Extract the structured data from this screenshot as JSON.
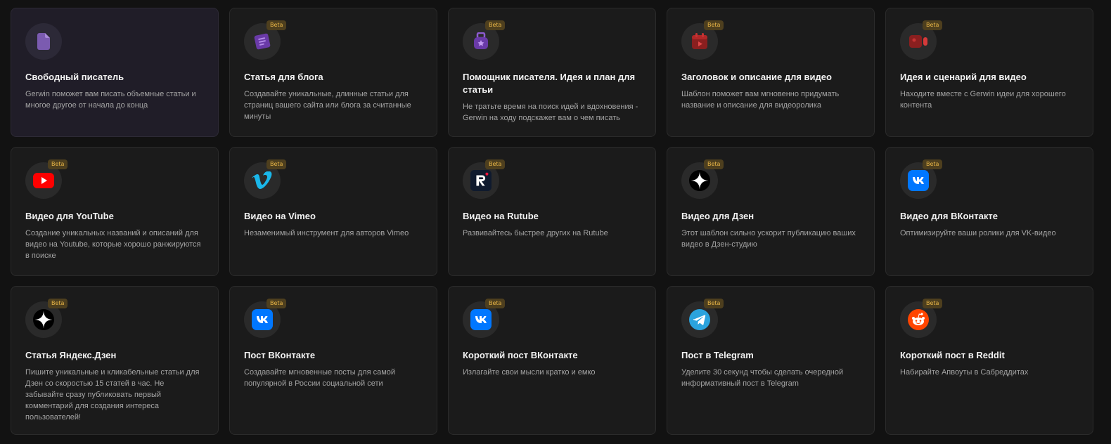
{
  "badge_label": "Beta",
  "cards": [
    {
      "title": "Свободный писатель",
      "desc": "Gerwin поможет вам писать объемные статьи и многое другое от начала до конца",
      "icon": "document-icon",
      "beta": false
    },
    {
      "title": "Статья для блога",
      "desc": "Создавайте уникальные, длинные статьи для страниц вашего сайта или блога за считанные минуты",
      "icon": "blog-article-icon",
      "beta": true
    },
    {
      "title": "Помощник писателя. Идея и план для статьи",
      "desc": "Не тратьте время на поиск идей и вдохновения - Gerwin на ходу подскажет вам о чем писать",
      "icon": "writer-assistant-icon",
      "beta": true
    },
    {
      "title": "Заголовок и описание для видео",
      "desc": "Шаблон поможет вам мгновенно придумать название и описание для видеоролика",
      "icon": "video-calendar-icon",
      "beta": true
    },
    {
      "title": "Идея и сценарий для видео",
      "desc": "Находите вместе с Gerwin идеи для хорошего контента",
      "icon": "video-camera-icon",
      "beta": true
    },
    {
      "title": "Видео для YouTube",
      "desc": "Создание уникальных названий и описаний для видео на Youtube, которые хорошо ранжируются в поиске",
      "icon": "youtube-icon",
      "beta": true
    },
    {
      "title": "Видео на Vimeo",
      "desc": "Незаменимый инструмент для авторов Vimeo",
      "icon": "vimeo-icon",
      "beta": true
    },
    {
      "title": "Видео на Rutube",
      "desc": "Развивайтесь быстрее других на Rutube",
      "icon": "rutube-icon",
      "beta": true
    },
    {
      "title": "Видео для Дзен",
      "desc": "Этот шаблон сильно ускорит публикацию ваших видео в Дзен-студию",
      "icon": "dzen-icon",
      "beta": true
    },
    {
      "title": "Видео для ВКонтакте",
      "desc": "Оптимизируйте ваши ролики для VK-видео",
      "icon": "vk-icon",
      "beta": true
    },
    {
      "title": "Статья Яндекс.Дзен",
      "desc": "Пишите уникальные и кликабельные статьи для Дзен со скоростью 15 статей в час. Не забывайте сразу публиковать первый комментарий для создания интереса пользователей!",
      "icon": "dzen-icon",
      "beta": true
    },
    {
      "title": "Пост ВКонтакте",
      "desc": "Создавайте мгновенные посты для самой популярной в России социальной сети",
      "icon": "vk-icon",
      "beta": true
    },
    {
      "title": "Короткий пост ВКонтакте",
      "desc": "Излагайте свои мысли кратко и емко",
      "icon": "vk-icon",
      "beta": true
    },
    {
      "title": "Пост в Telegram",
      "desc": "Уделите 30 секунд чтобы сделать очередной информативный пост в Telegram",
      "icon": "telegram-icon",
      "beta": true
    },
    {
      "title": "Короткий пост в Reddit",
      "desc": "Набирайте Апвоуты в Сабреддитах",
      "icon": "reddit-icon",
      "beta": true
    }
  ],
  "colors": {
    "background": "#121212",
    "card": "#1b1b1b",
    "card_selected": "#201d28",
    "badge_text": "#e9b647",
    "badge_bg": "#4e3f1e"
  }
}
